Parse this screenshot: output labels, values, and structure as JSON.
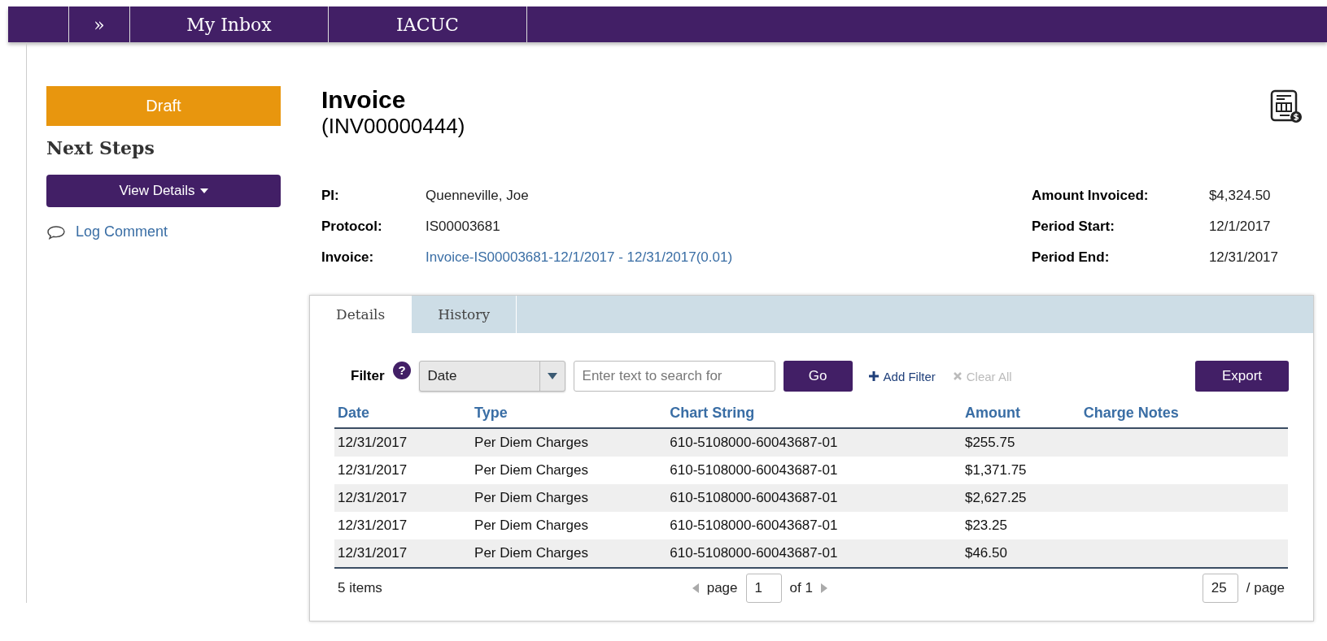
{
  "nav": {
    "items": [
      {
        "label": "»",
        "kind": "toggle"
      },
      {
        "label": "My Inbox",
        "kind": "link"
      },
      {
        "label": "IACUC",
        "kind": "link"
      }
    ]
  },
  "sidebar": {
    "status": "Draft",
    "heading": "Next Steps",
    "menu_button": "View Details",
    "links": [
      "Log Comment"
    ]
  },
  "header": {
    "title": "Invoice",
    "subtitle": "(INV00000444)"
  },
  "fields_left": [
    {
      "label": "PI:",
      "value": "Quenneville, Joe",
      "kind": "text"
    },
    {
      "label": "Protocol:",
      "value": "IS00003681",
      "kind": "text"
    },
    {
      "label": "Invoice:",
      "value": "Invoice-IS00003681-12/1/2017 - 12/31/2017(0.01)",
      "kind": "link"
    }
  ],
  "fields_right": [
    {
      "label": "Amount Invoiced:",
      "value": "$4,324.50"
    },
    {
      "label": "Period Start:",
      "value": "12/1/2017"
    },
    {
      "label": "Period End:",
      "value": "12/31/2017"
    }
  ],
  "tabs": [
    {
      "label": "Details",
      "selected": true
    },
    {
      "label": "History",
      "selected": false
    }
  ],
  "filter": {
    "label": "Filter",
    "help": "?",
    "field": "Date",
    "search_placeholder": "Enter text to search for",
    "go": "Go",
    "add": "Add Filter",
    "clear": "Clear All",
    "clear_disabled": true,
    "export": "Export"
  },
  "table": {
    "columns": [
      "Date",
      "Type",
      "Chart String",
      "Amount",
      "Charge Notes"
    ],
    "rows": [
      [
        "12/31/2017",
        "Per Diem Charges",
        "610-5108000-60043687-01",
        "$255.75",
        ""
      ],
      [
        "12/31/2017",
        "Per Diem Charges",
        "610-5108000-60043687-01",
        "$1,371.75",
        ""
      ],
      [
        "12/31/2017",
        "Per Diem Charges",
        "610-5108000-60043687-01",
        "$2,627.25",
        ""
      ],
      [
        "12/31/2017",
        "Per Diem Charges",
        "610-5108000-60043687-01",
        "$23.25",
        ""
      ],
      [
        "12/31/2017",
        "Per Diem Charges",
        "610-5108000-60043687-01",
        "$46.50",
        ""
      ]
    ]
  },
  "pager": {
    "count": "5 items",
    "page_label": "page",
    "page": "1",
    "of": "of 1",
    "per_page": "25",
    "per_page_label": "/ page"
  }
}
